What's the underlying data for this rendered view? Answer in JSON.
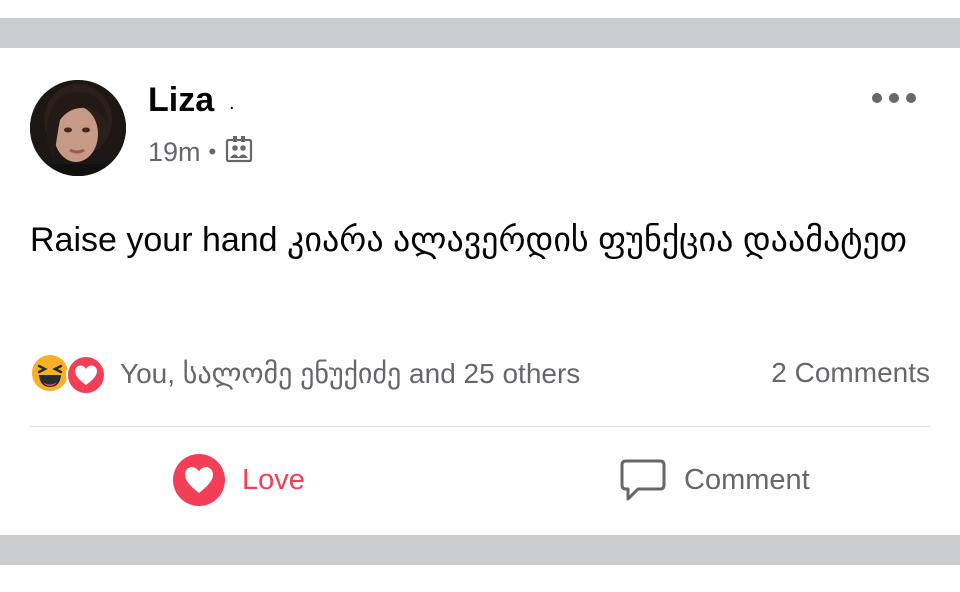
{
  "post": {
    "author": "Liza",
    "author_suffix": ".",
    "time": "19m",
    "meta_separator": "•",
    "audience_icon": "group-privacy-icon",
    "text": "Raise your hand  კიარა ალავერდის ფუნქცია დაამატეთ"
  },
  "reactions": {
    "icons": [
      "haha-reaction-icon",
      "love-reaction-icon"
    ],
    "summary": "You, სალომე ენუქიძე and 25 others",
    "comments": "2 Comments"
  },
  "actions": {
    "love_label": "Love",
    "comment_label": "Comment"
  },
  "colors": {
    "love": "#f33e58",
    "secondary_text": "#65676b",
    "separator_band": "#c9ccd1",
    "haha_yellow": "#f7b125"
  }
}
